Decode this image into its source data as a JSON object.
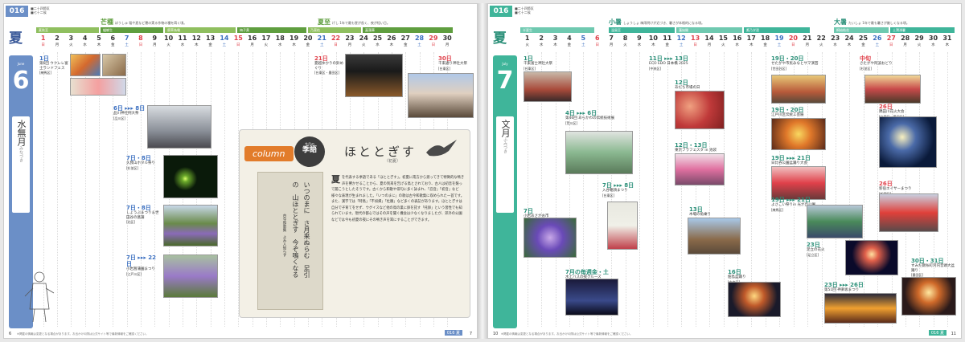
{
  "left": {
    "page_tag": "016",
    "sub_label": "■二十四節気\n■七十二候",
    "season": "夏",
    "month_num": "6",
    "month_eng": "June",
    "month_jp": "水無月",
    "month_jp_ruby": "みなづき",
    "sekki": [
      {
        "name": "芒種",
        "ruby": "ぼうしゅ",
        "desc": "稲や麦など穂の実る作物の種を蒔く頃。"
      },
      {
        "name": "夏至",
        "ruby": "げし",
        "desc": "1年で最も昼が長く、夜が短い日。"
      }
    ],
    "terms": [
      "麦秋至",
      "蟷螂生",
      "腐草為螢",
      "梅子黄",
      "乃東枯",
      "菖蒲華"
    ],
    "days": [
      {
        "d": "1",
        "w": "日"
      },
      {
        "d": "2",
        "w": "月"
      },
      {
        "d": "3",
        "w": "火"
      },
      {
        "d": "4",
        "w": "水"
      },
      {
        "d": "5",
        "w": "木"
      },
      {
        "d": "6",
        "w": "金"
      },
      {
        "d": "7",
        "w": "土"
      },
      {
        "d": "8",
        "w": "日"
      },
      {
        "d": "9",
        "w": "月"
      },
      {
        "d": "10",
        "w": "火"
      },
      {
        "d": "11",
        "w": "水"
      },
      {
        "d": "12",
        "w": "木"
      },
      {
        "d": "13",
        "w": "金"
      },
      {
        "d": "14",
        "w": "土"
      },
      {
        "d": "15",
        "w": "日"
      },
      {
        "d": "16",
        "w": "月"
      },
      {
        "d": "17",
        "w": "火"
      },
      {
        "d": "18",
        "w": "水"
      },
      {
        "d": "19",
        "w": "木"
      },
      {
        "d": "20",
        "w": "金"
      },
      {
        "d": "21",
        "w": "土"
      },
      {
        "d": "22",
        "w": "日"
      },
      {
        "d": "23",
        "w": "月"
      },
      {
        "d": "24",
        "w": "火"
      },
      {
        "d": "25",
        "w": "水"
      },
      {
        "d": "26",
        "w": "木"
      },
      {
        "d": "27",
        "w": "金"
      },
      {
        "d": "28",
        "w": "土"
      },
      {
        "d": "29",
        "w": "日"
      },
      {
        "d": "30",
        "w": "月"
      }
    ],
    "events": [
      {
        "date": "1日",
        "name": "第6回 ウクレレ富士ランドフェス",
        "venue": "[練馬区]"
      },
      {
        "date": "21日",
        "name": "夏越ゆかりの鈴めぐり",
        "venue": "[台東区・墨田区]"
      },
      {
        "date": "30日",
        "name": "千束通り神社大祭",
        "venue": "[台東区]"
      },
      {
        "date": "6日 ▸▸▸ 8日",
        "name": "品川神社例大祭",
        "venue": "[品川区]"
      },
      {
        "date": "7日・8日",
        "name": "久我山ホタル祭り",
        "venue": "[杉並区]"
      },
      {
        "date": "7日・8日",
        "name": "しょうぶまつり＆世田谷の菖蒲",
        "venue": "[北区]"
      },
      {
        "date": "7日 ▸▸▸ 22日",
        "name": "小岩菖蒲園まつり",
        "venue": "[江戸川区]"
      }
    ],
    "column": {
      "tag": "column",
      "kigo_top": "今月の",
      "kigo": "季語",
      "head": "ほととぎす",
      "sub": "（初夏）",
      "poem": "いつのまに　さ月来ぬらむ　足引の　山ほととぎす　今ぞ鳴くなる",
      "author": "古今和歌集　よみ人知らず",
      "initial": "夏",
      "body": "を代表する季語である「ほととぎす」。初夏に南方から渡ってきて特徴的な鳴き声を響かせることから、夏の到来を告げる鳥とされており、古人は初音を競って聞こうとしたそうです。古くから和歌や俳句に多く詠まれ、「忍音」「初音」など様々な表現が生まれました。「いつのまに」の歌は古今和歌集に収められた一首です。また、漢字では「時鳥」「不如帰」「杜鵑」など多くの表記があります。ほととぎすは自分で子育てをせず、ウグイスなど他の鳥の巣に卵を託す「托卵」という習性でも知られています。現代の都心ではその声を聞く機会は少なくなりましたが、郊外の公園などでは今も初夏の夜にその鳴き声を耳にすることができます。"
    },
    "footer": "※掲載の情報は変更となる場合があります。お出かけの際は公式サイト等で最新情報をご確認ください。",
    "page_num": "6",
    "page_num_r": "7",
    "badge": "016 夏"
  },
  "right": {
    "page_tag": "016",
    "sub_label": "■二十四節気\n■七十二候",
    "season": "夏",
    "month_num": "7",
    "month_eng": "July",
    "month_jp": "文月",
    "month_jp_ruby": "ふみづき",
    "sekki": [
      {
        "name": "小暑",
        "ruby": "しょうしょ",
        "desc": "梅雨明けが近づき、暑さが本格的になる頃。"
      },
      {
        "name": "大暑",
        "ruby": "たいしょ",
        "desc": "1年で最も暑さが厳しくなる頃。"
      }
    ],
    "terms": [
      "半夏生",
      "温風至",
      "蓮始開",
      "鷹乃学習",
      "桐始結花",
      "土潤溽暑"
    ],
    "days": [
      {
        "d": "1",
        "w": "火"
      },
      {
        "d": "2",
        "w": "水"
      },
      {
        "d": "3",
        "w": "木"
      },
      {
        "d": "4",
        "w": "金"
      },
      {
        "d": "5",
        "w": "土"
      },
      {
        "d": "6",
        "w": "日"
      },
      {
        "d": "7",
        "w": "月"
      },
      {
        "d": "8",
        "w": "火"
      },
      {
        "d": "9",
        "w": "水"
      },
      {
        "d": "10",
        "w": "木"
      },
      {
        "d": "11",
        "w": "金"
      },
      {
        "d": "12",
        "w": "土"
      },
      {
        "d": "13",
        "w": "日"
      },
      {
        "d": "14",
        "w": "月"
      },
      {
        "d": "15",
        "w": "火"
      },
      {
        "d": "16",
        "w": "水"
      },
      {
        "d": "17",
        "w": "木"
      },
      {
        "d": "18",
        "w": "金"
      },
      {
        "d": "19",
        "w": "土"
      },
      {
        "d": "20",
        "w": "日"
      },
      {
        "d": "21",
        "w": "月"
      },
      {
        "d": "22",
        "w": "火"
      },
      {
        "d": "23",
        "w": "水"
      },
      {
        "d": "24",
        "w": "木"
      },
      {
        "d": "25",
        "w": "金"
      },
      {
        "d": "26",
        "w": "土"
      },
      {
        "d": "27",
        "w": "日"
      },
      {
        "d": "28",
        "w": "月"
      },
      {
        "d": "29",
        "w": "火"
      },
      {
        "d": "30",
        "w": "水"
      },
      {
        "d": "31",
        "w": "木"
      }
    ],
    "events": [
      {
        "date": "1日",
        "name": "千束富士神社大祭",
        "venue": "[台東区]"
      },
      {
        "date": "11日 ▸▸▸ 13日",
        "name": "ECO EDO 日本橋 2025",
        "venue": "[中央区]"
      },
      {
        "date": "19日・20日",
        "name": "せたがや市民みなとサマ演芸",
        "venue": "[世田谷区]"
      },
      {
        "date": "中旬",
        "name": "さたがや阿波おどり",
        "venue": "[杉並区]"
      },
      {
        "date": "4日 ▸▸▸ 6日",
        "name": "第46回 あらかわの伝統技術展",
        "venue": "[荒川区]"
      },
      {
        "date": "12日",
        "name": "あだち市場の日",
        "venue": "[足立区]"
      },
      {
        "date": "19日・20日",
        "name": "江戸川区伝統工芸展",
        "venue": "[江戸川区]"
      },
      {
        "date": "26日",
        "name": "隅田川花火大会",
        "venue": "[台東区・墨田区]"
      },
      {
        "date": "12日・13日",
        "name": "東京フラフェスタ in 池袋",
        "venue": "[豊島区]"
      },
      {
        "date": "19日 ▸▸▸ 21日",
        "name": "日比谷公園盆踊り大会",
        "venue": "[千代田区]"
      },
      {
        "date": "7日 ▸▸▸ 8日",
        "name": "入谷朝顔まつり",
        "venue": "[台東区]"
      },
      {
        "date": "7日",
        "name": "小岩あさがお市",
        "venue": "[江戸川区]"
      },
      {
        "date": "26日",
        "name": "新宿エイサーまつり",
        "venue": "[新宿区]"
      },
      {
        "date": "13日",
        "name": "木場の角乗り",
        "venue": "[江東区]"
      },
      {
        "date": "19日 ▸▸▸ 21日",
        "name": "よさこい祭りin 光が丘公園",
        "venue": "[練馬区]"
      },
      {
        "date": "23日",
        "name": "足立の花火",
        "venue": "[足立区]"
      },
      {
        "date": "7月の毎週金・土",
        "name": "水上バスの夜クルーズ",
        "venue": "[中央区]"
      },
      {
        "date": "16日",
        "name": "佃島盆踊り",
        "venue": "[中央区]"
      },
      {
        "date": "30日・31日",
        "name": "すみだ錦糸町河内音頭大盆踊り",
        "venue": "[墨田区]"
      },
      {
        "date": "23日 ▸▸▸ 26日",
        "name": "第51回 神楽坂まつり",
        "venue": "[新宿区]"
      }
    ],
    "footer": "※掲載の情報は変更となる場合があります。お出かけの際は公式サイト等で最新情報をご確認ください。",
    "page_num": "10",
    "page_num_r": "11",
    "badge": "016 夏"
  },
  "colors": {
    "left_accent": "#6b8fc7",
    "left_green": "#5f9e3f",
    "right_accent": "#3fb59a",
    "sunday": "#e0404a",
    "saturday": "#3b6fc0"
  }
}
